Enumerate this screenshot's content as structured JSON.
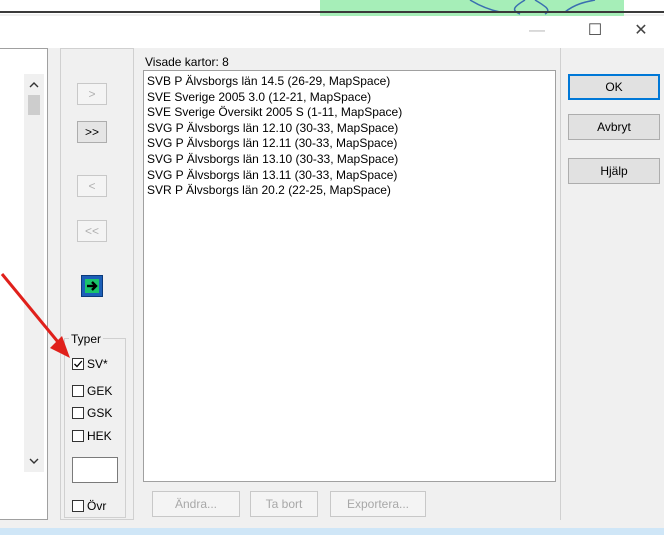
{
  "window": {
    "minimize_glyph": "—",
    "maximize_glyph": "☐",
    "close_glyph": "✕"
  },
  "shown_maps": {
    "label": "Visade kartor: 8",
    "items": [
      "SVB P Älvsborgs län 14.5 (26-29, MapSpace)",
      "SVE Sverige 2005 3.0 (12-21, MapSpace)",
      "SVE Sverige Översikt 2005 S (1-11, MapSpace)",
      "SVG P Älvsborgs län 12.10 (30-33, MapSpace)",
      "SVG P Älvsborgs län 12.11 (30-33, MapSpace)",
      "SVG P Älvsborgs län 13.10 (30-33, MapSpace)",
      "SVG P Älvsborgs län 13.11 (30-33, MapSpace)",
      "SVR P Älvsborgs län 20.2 (22-25, MapSpace)"
    ]
  },
  "move_buttons": {
    "add_one": ">",
    "add_all": ">>",
    "remove_one": "<",
    "remove_all": "<<"
  },
  "types": {
    "legend": "Typer",
    "options": [
      {
        "label": "SV*",
        "checked": true
      },
      {
        "label": "GEK",
        "checked": false
      },
      {
        "label": "GSK",
        "checked": false
      },
      {
        "label": "HEK",
        "checked": false
      }
    ],
    "other": {
      "label": "Övr",
      "checked": false
    }
  },
  "bottom_buttons": {
    "edit": "Ändra...",
    "delete": "Ta bort",
    "export": "Exportera..."
  },
  "dialog_buttons": {
    "ok": "OK",
    "cancel": "Avbryt",
    "help": "Hjälp"
  },
  "colors": {
    "annotation_arrow": "#e0201b",
    "default_button_border": "#0078d7",
    "background_art": "#a6eeb8"
  }
}
